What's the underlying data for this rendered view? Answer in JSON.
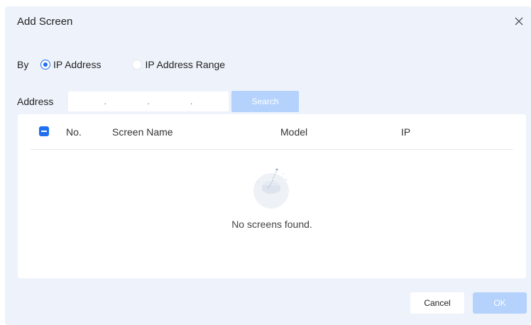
{
  "dialog": {
    "title": "Add Screen",
    "close_icon": "close-icon"
  },
  "by": {
    "label": "By",
    "options": [
      {
        "label": "IP Address",
        "checked": true
      },
      {
        "label": "IP Address Range",
        "checked": false
      }
    ]
  },
  "address": {
    "label": "Address",
    "separators": [
      ".",
      ".",
      "."
    ],
    "search_label": "Search"
  },
  "table": {
    "columns": [
      "No.",
      "Screen Name",
      "Model",
      "IP"
    ],
    "select_all_state": "indeterminate",
    "empty_text": "No screens found.",
    "empty_icon": "empty-box-icon"
  },
  "footer": {
    "cancel_label": "Cancel",
    "ok_label": "OK"
  },
  "colors": {
    "accent": "#1f6ff0",
    "disabled_button": "#b4d2fb",
    "dialog_bg": "#eef3fb"
  }
}
